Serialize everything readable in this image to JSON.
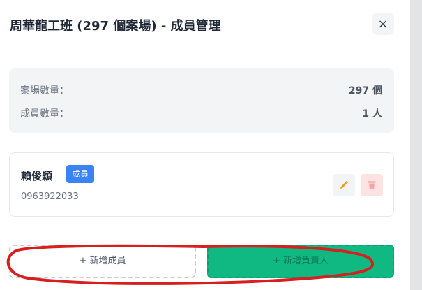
{
  "header": {
    "title": "周華龍工班 (297 個案場) - 成員管理",
    "close_label": "×"
  },
  "stats": [
    {
      "label": "案場數量：",
      "value": "297 個"
    },
    {
      "label": "成員數量：",
      "value": "1 人"
    }
  ],
  "members": [
    {
      "name": "賴俊穎",
      "role": "成員",
      "phone": "0963922033"
    }
  ],
  "actions": {
    "add_member_label": "+ 新增成員",
    "add_leader_label": "+ 新增負責人"
  },
  "colors": {
    "badge": "#3b82f6",
    "edit_icon": "#f59e0b",
    "delete_icon": "#ef4444",
    "add_leader": "#10b981",
    "annotation_stroke": "#d61f1f"
  },
  "icons": {
    "close": "close-icon",
    "edit": "pencil-icon",
    "delete": "trash-icon"
  }
}
